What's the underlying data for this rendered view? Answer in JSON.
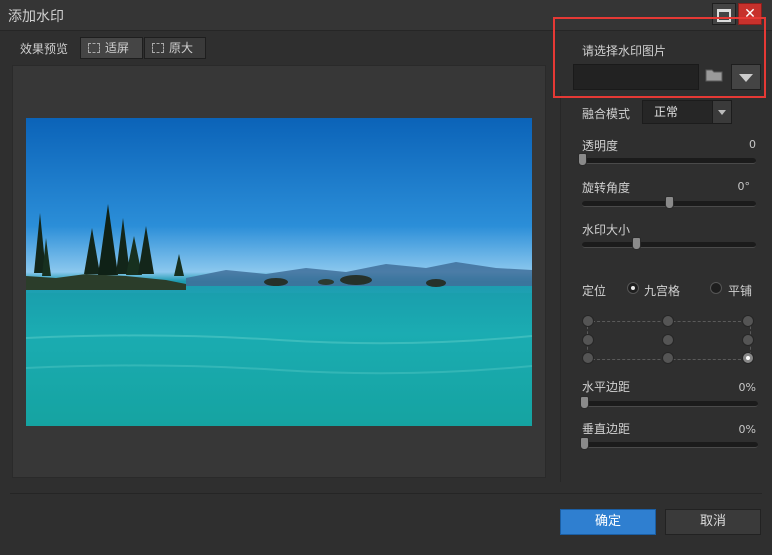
{
  "window": {
    "title": "添加水印"
  },
  "preview": {
    "label": "效果预览",
    "tabs": [
      {
        "label": "适屏"
      },
      {
        "label": "原大"
      }
    ]
  },
  "watermark": {
    "label": "请选择水印图片",
    "value": ""
  },
  "blend": {
    "label": "融合模式",
    "value": "正常"
  },
  "opacity": {
    "label": "透明度",
    "value": "0",
    "level": 0
  },
  "rotation": {
    "label": "旋转角度",
    "value": "0°",
    "level": 0.5
  },
  "size": {
    "label": "水印大小",
    "level": 0.31
  },
  "positioning": {
    "label": "定位",
    "options": [
      {
        "label": "九宫格",
        "selected": true
      },
      {
        "label": "平铺",
        "selected": false
      }
    ],
    "grid_selected": "bottom-right"
  },
  "h_margin": {
    "label": "水平边距",
    "value": "0%",
    "level": 0
  },
  "v_margin": {
    "label": "垂直边距",
    "value": "0%",
    "level": 0
  },
  "buttons": {
    "ok": "确定",
    "cancel": "取消"
  },
  "colors": {
    "accent": "#2f7fd0",
    "close": "#c7312c",
    "highlight": "#e53935"
  }
}
